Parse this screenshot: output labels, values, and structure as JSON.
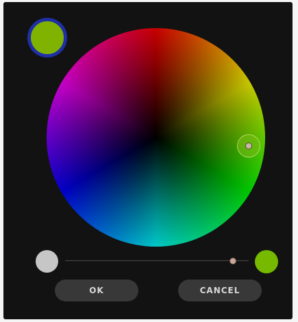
{
  "dialog": {
    "selected_color": "#7fb300",
    "swatch_ring_color": "#1f2fa6",
    "brightness": {
      "start_color": "#c6c6c6",
      "end_color": "#76b900",
      "value": 0.915
    },
    "buttons": {
      "ok": "OK",
      "cancel": "CANCEL"
    }
  }
}
